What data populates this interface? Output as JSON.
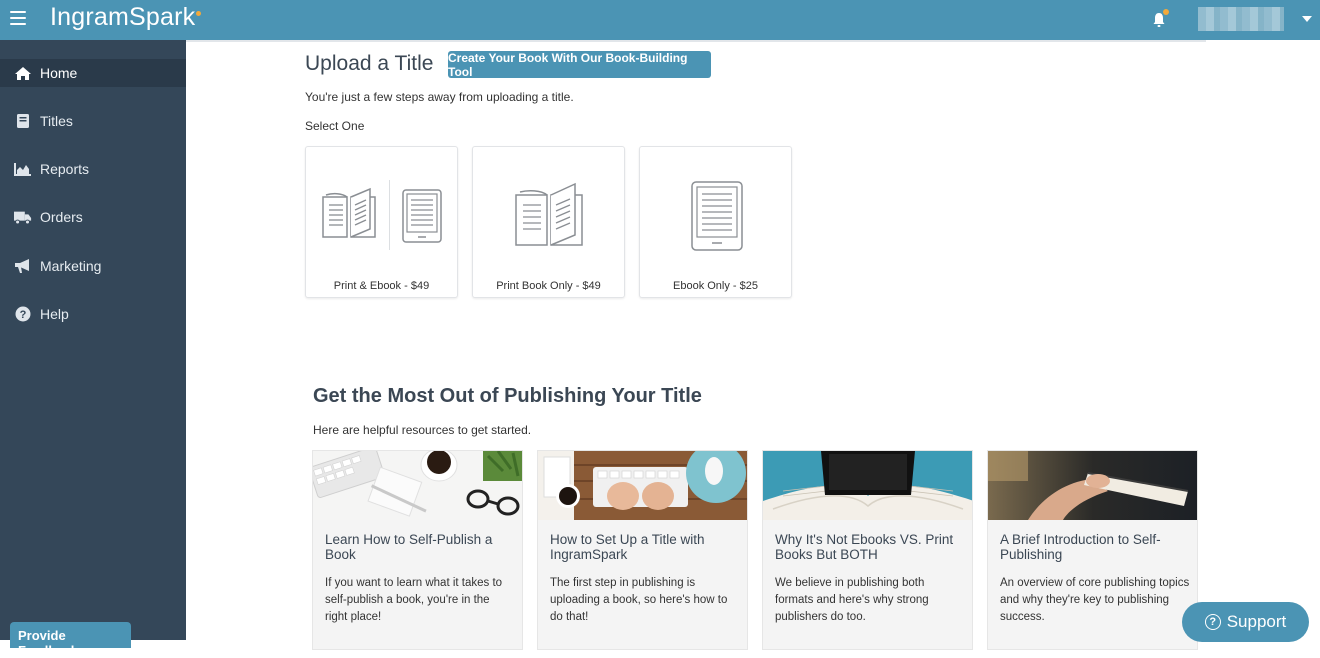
{
  "header": {
    "brand": "IngramSpark",
    "account_name": ""
  },
  "sidebar": {
    "items": [
      {
        "label": "Home",
        "icon": "home-icon"
      },
      {
        "label": "Titles",
        "icon": "book-icon"
      },
      {
        "label": "Reports",
        "icon": "chart-icon"
      },
      {
        "label": "Orders",
        "icon": "truck-icon"
      },
      {
        "label": "Marketing",
        "icon": "megaphone-icon"
      },
      {
        "label": "Help",
        "icon": "question-icon"
      }
    ],
    "feedback_label": "Provide Feedback"
  },
  "upload": {
    "title": "Upload a Title",
    "create_button": "Create Your Book With Our Book-Building Tool",
    "subtitle": "You're just a few steps away from uploading a title.",
    "select_label": "Select One",
    "options": [
      {
        "label": "Print & Ebook - $49"
      },
      {
        "label": "Print Book Only - $49"
      },
      {
        "label": "Ebook Only - $25"
      }
    ]
  },
  "resources": {
    "title": "Get the Most Out of Publishing Your Title",
    "subtitle": "Here are helpful resources to get started.",
    "cards": [
      {
        "title": "Learn How to Self-Publish a Book",
        "body": "If you want to learn what it takes to self-publish a book, you're in the right place!"
      },
      {
        "title": "How to Set Up a Title with IngramSpark",
        "body": "The first step in publishing is uploading a book, so here's how to do that!"
      },
      {
        "title": "Why It's Not Ebooks VS. Print Books But BOTH",
        "body": "We believe in publishing both formats and here's why strong publishers do too."
      },
      {
        "title": "A Brief Introduction to Self-Publishing",
        "body": "An overview of core publishing topics and why they're key to publishing success."
      }
    ]
  },
  "support": {
    "label": "Support"
  },
  "colors": {
    "accent": "#4b94b4",
    "sidebar": "#344759",
    "sidebar_active": "#2a3a4a",
    "brand_dot": "#f2a93b"
  }
}
